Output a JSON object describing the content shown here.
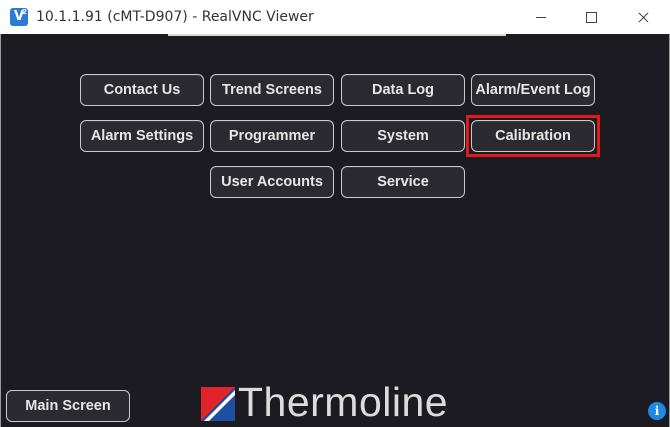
{
  "window": {
    "title": "10.1.1.91 (cMT-D907) - RealVNC Viewer",
    "icon": "realvnc-icon"
  },
  "menu": {
    "row1": [
      "Contact Us",
      "Trend Screens",
      "Data Log",
      "Alarm/Event Log"
    ],
    "row2": [
      "Alarm Settings",
      "Programmer",
      "System",
      "Calibration"
    ],
    "row3": [
      "User Accounts",
      "Service"
    ],
    "highlighted": "Calibration",
    "highlight_color": "#e0191b"
  },
  "footer": {
    "main_screen_label": "Main Screen",
    "brand": "Thermoline",
    "info_label": "i"
  },
  "colors": {
    "screen_bg": "#1d1b22",
    "button_bg": "#2c2a31",
    "logo_red": "#e3232a",
    "logo_blue": "#1f4fa0"
  }
}
